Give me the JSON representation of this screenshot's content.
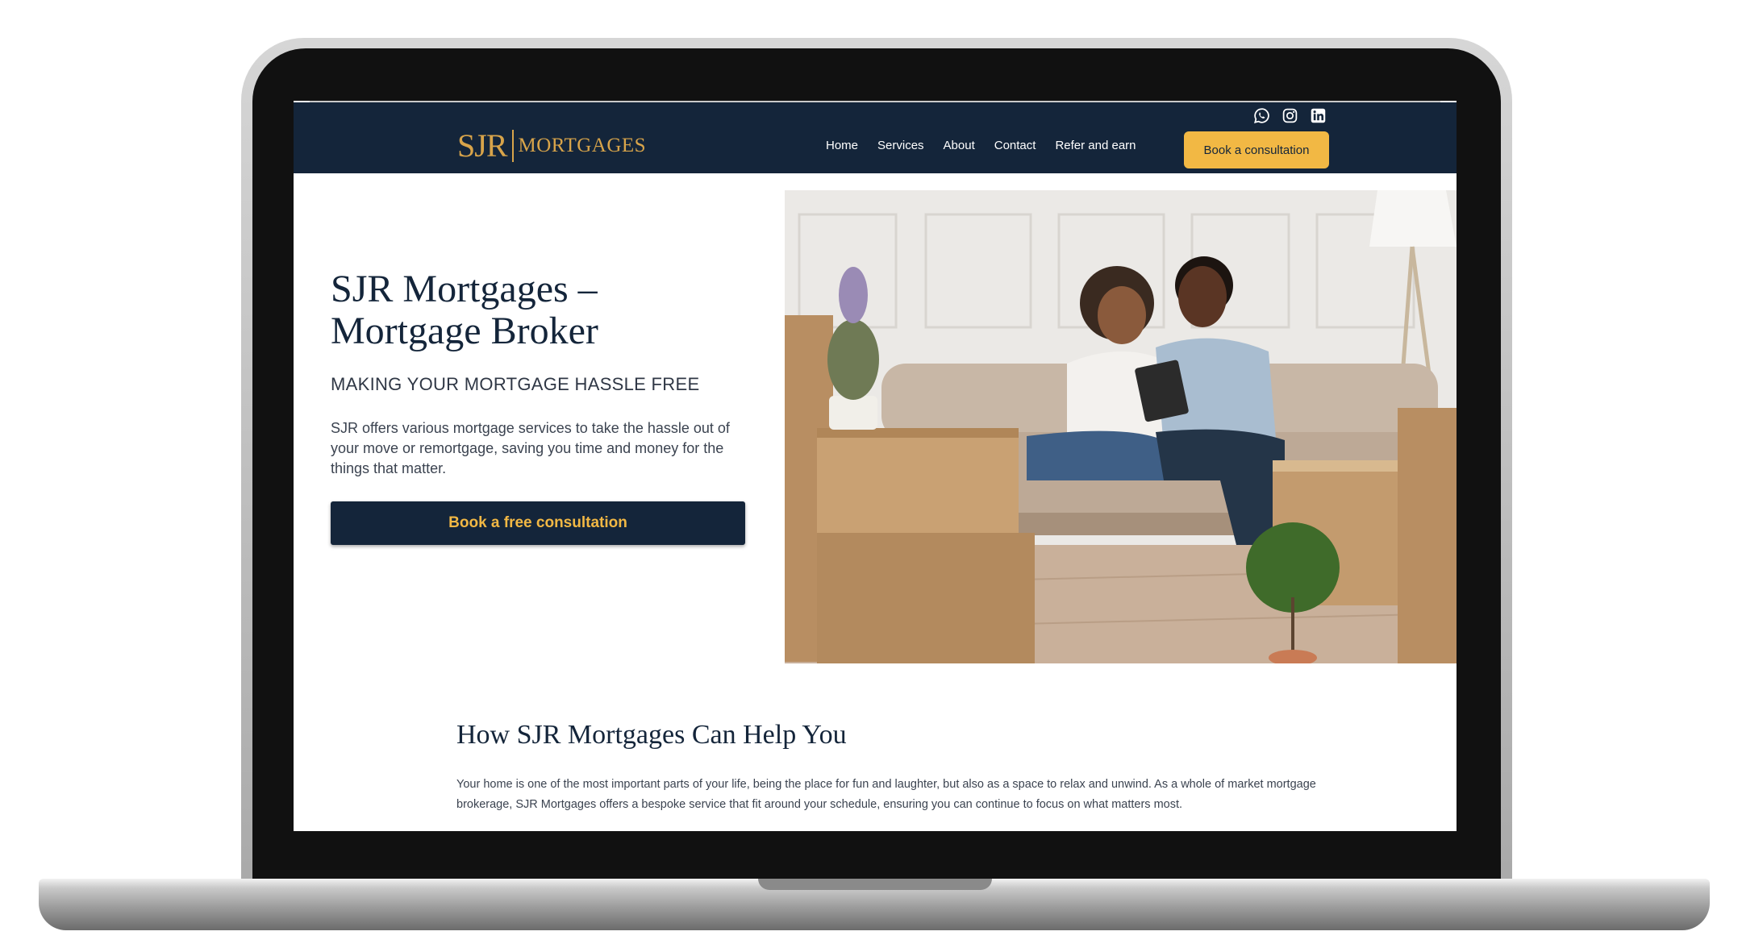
{
  "brand": {
    "logo_mark": "SJR",
    "logo_word": "MORTGAGES",
    "navy": "#14253a",
    "gold": "#d8a44a",
    "accent": "#f2b844"
  },
  "social": [
    {
      "icon": "whatsapp-icon"
    },
    {
      "icon": "instagram-icon"
    },
    {
      "icon": "linkedin-icon"
    }
  ],
  "nav": {
    "items": [
      "Home",
      "Services",
      "About",
      "Contact",
      "Refer and earn"
    ],
    "cta_label": "Book a consultation"
  },
  "hero": {
    "title": "SJR Mortgages – Mortgage Broker",
    "subtitle": "MAKING YOUR MORTGAGE HASSLE FREE",
    "description": "SJR offers various mortgage services to take the hassle out of your move or remortgage, saving you time and money for the things that matter.",
    "cta_label": "Book a free consultation"
  },
  "help": {
    "title": "How SJR Mortgages Can Help You",
    "text": "Your home is one of the most important parts of your life, being the place for fun and laughter, but also as a space to relax and unwind. As a whole of market mortgage brokerage, SJR Mortgages offers a bespoke service that fit around your schedule, ensuring you can continue to focus on what matters most."
  }
}
